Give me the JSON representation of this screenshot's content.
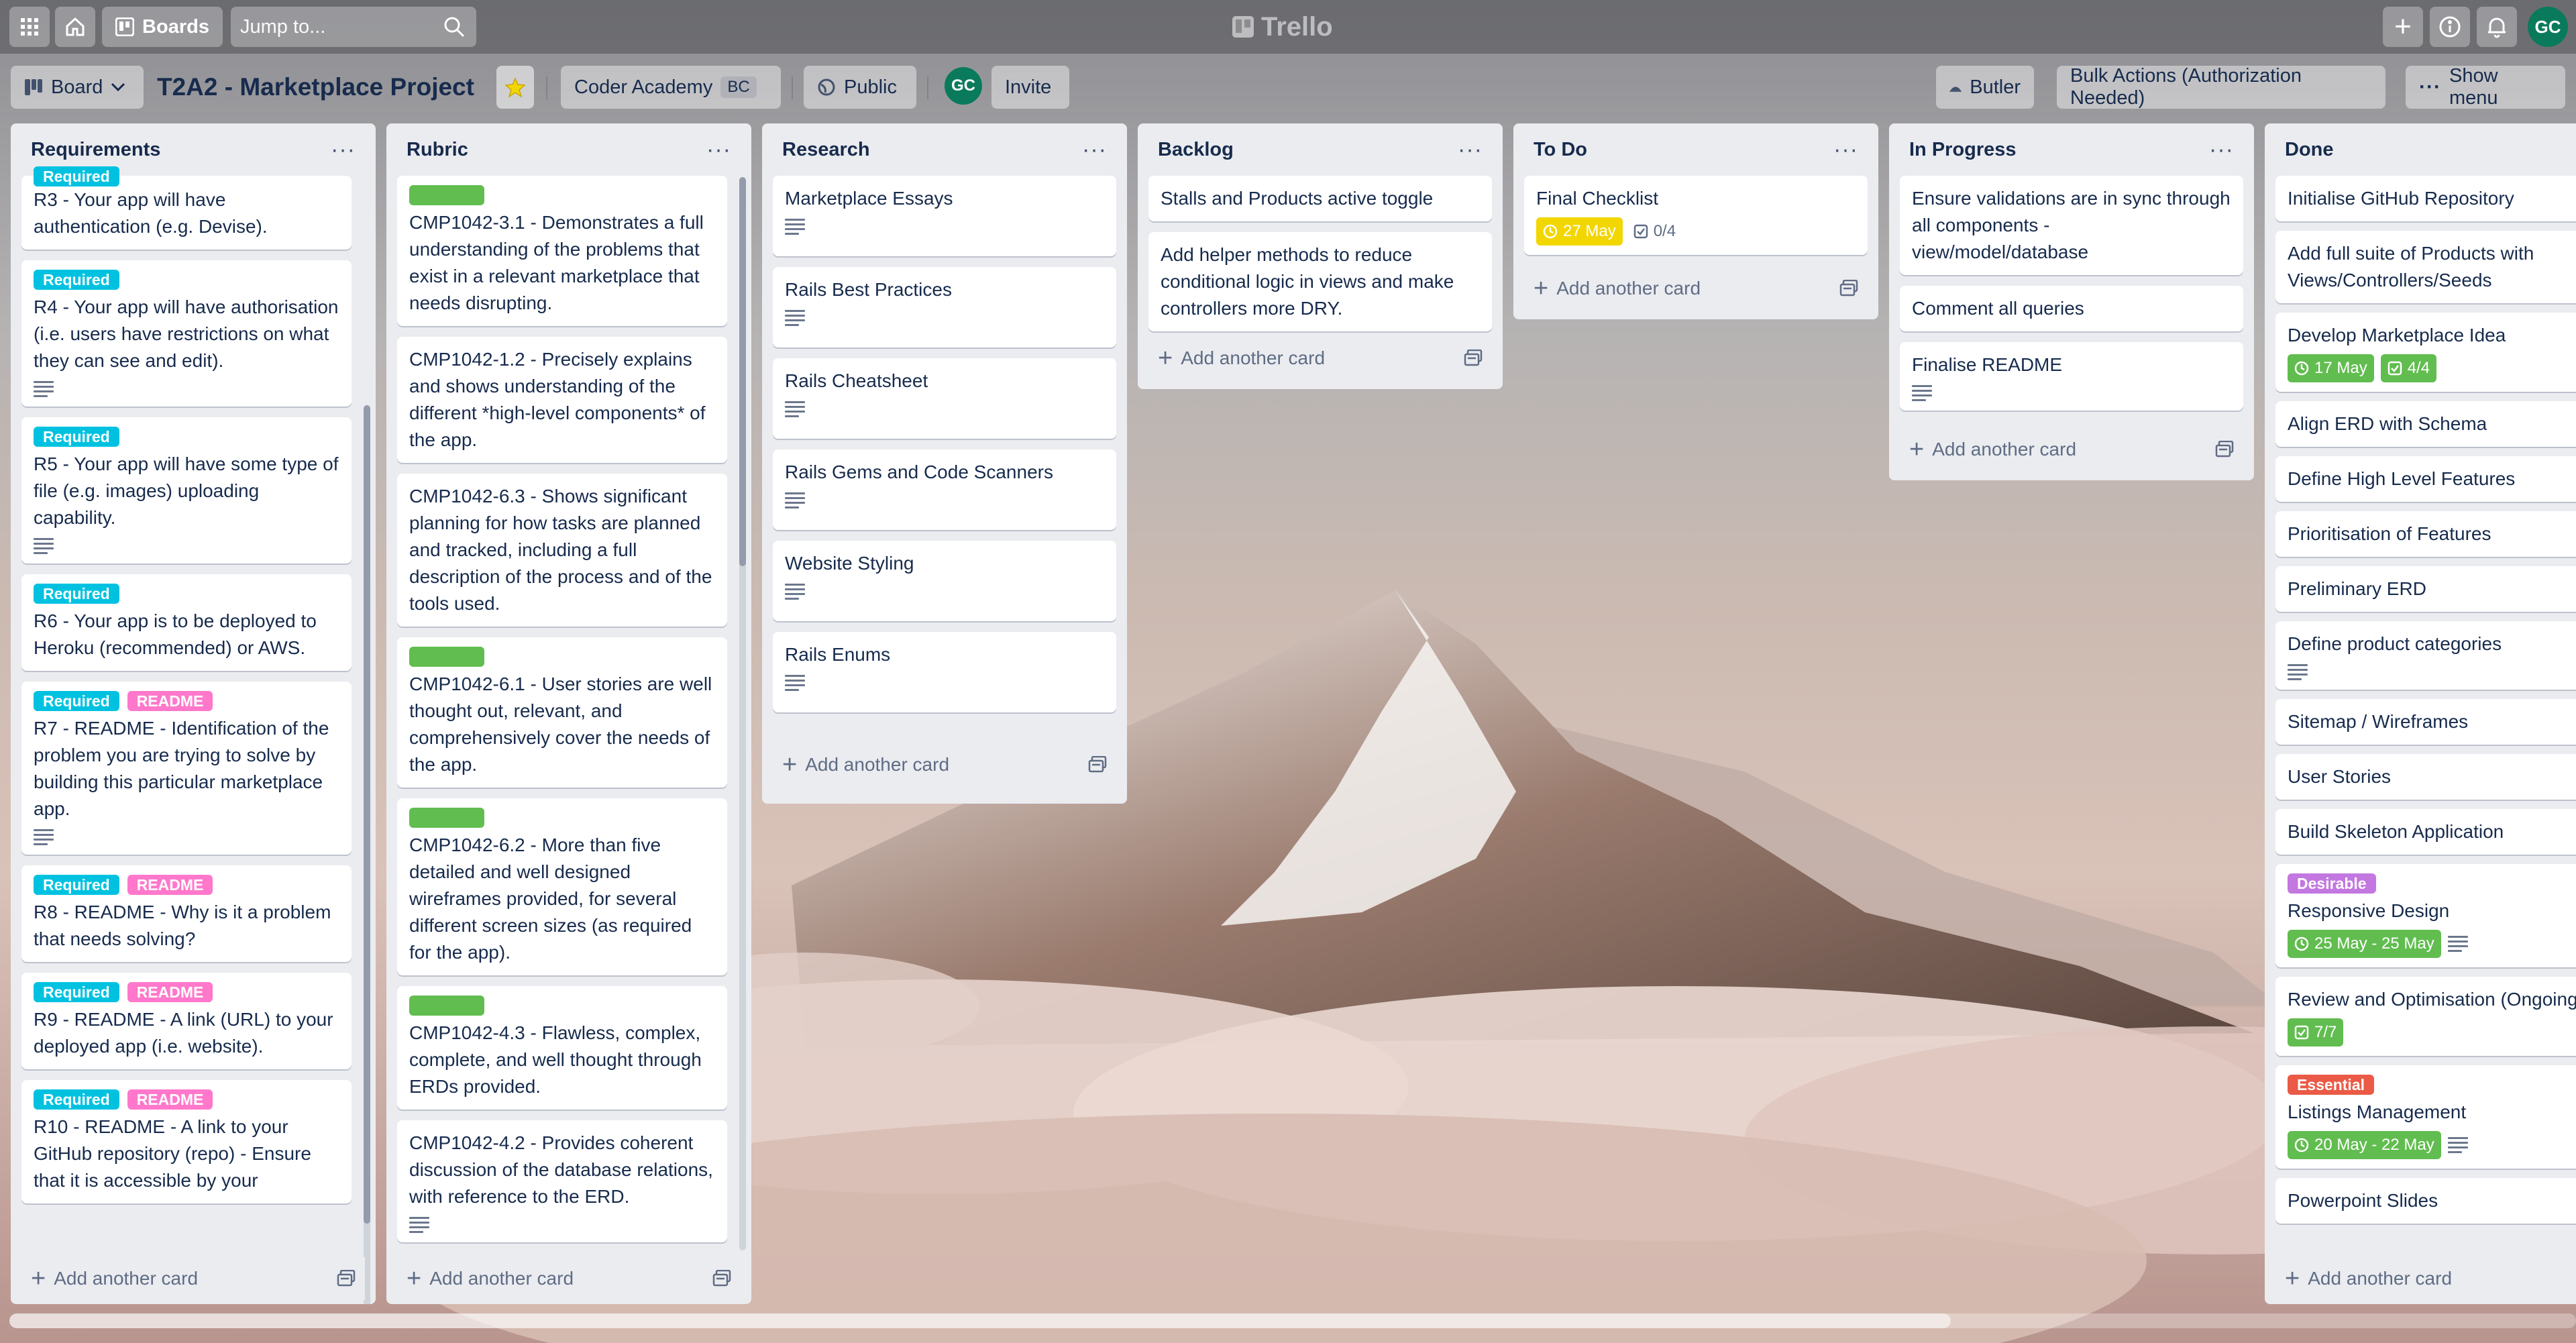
{
  "header": {
    "boards_label": "Boards",
    "search_placeholder": "Jump to...",
    "logo": "Trello",
    "user_initials": "GC"
  },
  "board": {
    "view_label": "Board",
    "title": "T2A2 - Marketplace Project",
    "workspace": "Coder Academy",
    "workspace_tag": "BC",
    "visibility": "Public",
    "member_initials": "GC",
    "invite": "Invite",
    "butler": "Butler",
    "bulk_actions": "Bulk Actions (Authorization Needed)",
    "show_menu": "Show menu"
  },
  "add_card_label": "Add another card",
  "lists": {
    "requirements": {
      "name": "Requirements",
      "partial_label": "Required",
      "cards": [
        {
          "text": "R3 - Your app will have authentication (e.g. Devise)."
        },
        {
          "labels": [
            "Required"
          ],
          "text": "R4 - Your app will have authorisation (i.e. users have restrictions on what they can see and edit)."
        },
        {
          "labels": [
            "Required"
          ],
          "text": "R5 - Your app will have some type of file (e.g. images) uploading capability."
        },
        {
          "labels": [
            "Required"
          ],
          "text": "R6 - Your app is to be deployed to Heroku (recommended) or AWS."
        },
        {
          "labels": [
            "Required",
            "README"
          ],
          "text": "R7 - README - Identification of the problem you are trying to solve by building this particular marketplace app."
        },
        {
          "labels": [
            "Required",
            "README"
          ],
          "text": "R8 - README - Why is it a problem that needs solving?"
        },
        {
          "labels": [
            "Required",
            "README"
          ],
          "text": "R9 - README - A link (URL) to your deployed app (i.e. website)."
        },
        {
          "labels": [
            "Required",
            "README"
          ],
          "text": "R10 - README - A link to your GitHub repository (repo) - Ensure that it is accessible by your"
        }
      ]
    },
    "rubric": {
      "name": "Rubric",
      "cards": [
        {
          "text": "CMP1042-3.1 - Demonstrates a full understanding of the problems that exist in a relevant marketplace that needs disrupting."
        },
        {
          "text": "CMP1042-1.2 - Precisely explains and shows understanding of the different *high-level components* of the app."
        },
        {
          "text": "CMP1042-6.3 - Shows significant planning for how tasks are planned and tracked, including a full description of the process and of the tools used."
        },
        {
          "text": "CMP1042-6.1 - User stories are well thought out, relevant, and comprehensively cover the needs of the app."
        },
        {
          "text": "CMP1042-6.2 - More than five detailed and well designed wireframes provided, for several different screen sizes (as required for the app)."
        },
        {
          "text": "CMP1042-4.3 - Flawless, complex, complete, and well thought through ERDs provided."
        },
        {
          "text": "CMP1042-4.2 - Provides coherent discussion of the database relations, with reference to the ERD."
        }
      ]
    },
    "research": {
      "name": "Research",
      "cards": [
        {
          "text": "Marketplace Essays"
        },
        {
          "text": "Rails Best Practices"
        },
        {
          "text": "Rails Cheatsheet"
        },
        {
          "text": "Rails Gems and Code Scanners"
        },
        {
          "text": "Website Styling"
        },
        {
          "text": "Rails Enums"
        }
      ]
    },
    "backlog": {
      "name": "Backlog",
      "cards": [
        {
          "text": "Stalls and Products active toggle"
        },
        {
          "text": "Add helper methods to reduce conditional logic in views and make controllers more DRY."
        }
      ]
    },
    "todo": {
      "name": "To Do",
      "cards": [
        {
          "text": "Final Checklist",
          "due": "27 May",
          "checklist": "0/4"
        }
      ]
    },
    "in_progress": {
      "name": "In Progress",
      "cards": [
        {
          "text": "Ensure validations are in sync through all components - view/model/database"
        },
        {
          "text": "Comment all queries"
        },
        {
          "text": "Finalise README"
        }
      ]
    },
    "done": {
      "name": "Done",
      "cards": [
        {
          "text": "Initialise GitHub Repository"
        },
        {
          "text": "Add full suite of Products with Views/Controllers/Seeds"
        },
        {
          "text": "Develop Marketplace Idea",
          "due": "17 May",
          "checklist": "4/4"
        },
        {
          "text": "Align ERD with Schema"
        },
        {
          "text": "Define High Level Features"
        },
        {
          "text": "Prioritisation of Features"
        },
        {
          "text": "Preliminary ERD"
        },
        {
          "text": "Define product categories"
        },
        {
          "text": "Sitemap / Wireframes"
        },
        {
          "text": "User Stories"
        },
        {
          "text": "Build Skeleton Application"
        },
        {
          "label": "Desirable",
          "text": "Responsive Design",
          "due": "25 May - 25 May"
        },
        {
          "text": "Review and Optimisation (Ongoing)",
          "checklist": "7/7"
        },
        {
          "label": "Essential",
          "text": "Listings Management",
          "due": "20 May - 22 May"
        },
        {
          "text": "Powerpoint Slides"
        }
      ]
    }
  },
  "colors": {
    "required": "#00c2e0",
    "readme": "#ff78cb",
    "green": "#61bd4f",
    "due_soon": "#f2d600",
    "complete": "#61bd4f",
    "desirable": "#c377e0",
    "essential": "#eb5a46"
  }
}
